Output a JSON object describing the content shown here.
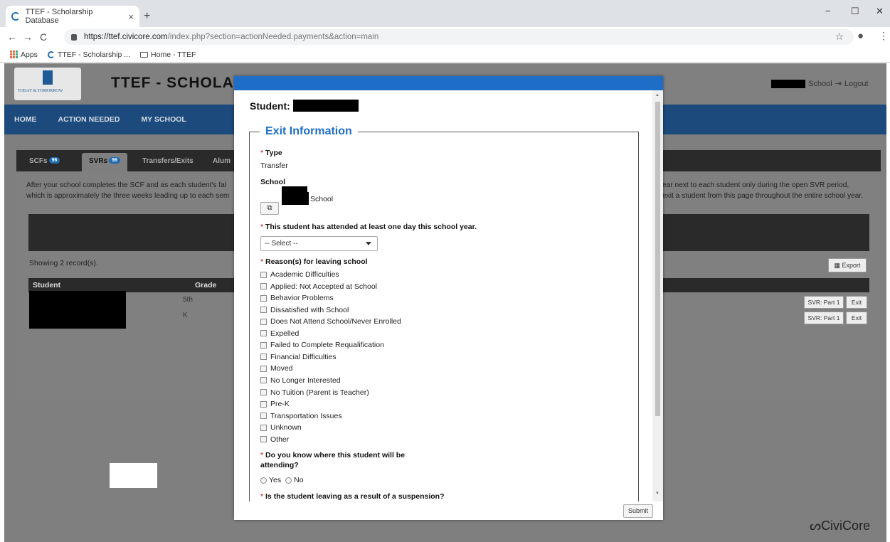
{
  "browser": {
    "tab_title": "TTEF - Scholarship Database",
    "tab_close": "×",
    "new_tab": "+",
    "url_host": "https://ttef.civicore.com",
    "url_path": "/index.php?section=actionNeeded.payments&action=main",
    "bookmarks": [
      "Apps",
      "TTEF - Scholarship ...",
      "Home - TTEF"
    ],
    "nav": {
      "back": "←",
      "forward": "→",
      "reload": "C"
    },
    "win": {
      "min": "−",
      "max": "☐",
      "close": "✕"
    },
    "star": "☆",
    "account": "●",
    "menu": "⋮"
  },
  "site": {
    "title": "TTEF - SCHOLARS",
    "logo_text": "TODAY & TOMORROW",
    "header_right_school": "School",
    "logout": "Logout",
    "nav": [
      "HOME",
      "ACTION NEEDED",
      "MY SCHOOL"
    ],
    "footer_brand": "CiviCore"
  },
  "panel": {
    "tabs": [
      {
        "label": "SCFs",
        "badge": "96"
      },
      {
        "label": "SVRs",
        "badge": "96"
      },
      {
        "label": "Transfers/Exits",
        "badge": ""
      },
      {
        "label": "Alum",
        "badge": ""
      }
    ],
    "desc_left_1": "After your school completes the SCF and as each student's fal",
    "desc_left_2": "which is approximately the three weeks leading up to each sem",
    "desc_right_1": "ear next to each student only during the open SVR period,",
    "desc_right_2": "exit a student from this page throughout the entire school year.",
    "showing": "Showing 2 record(s).",
    "export": "Export",
    "columns": [
      "Student",
      "Grade"
    ],
    "rows": [
      {
        "grade": "5th",
        "svr": "SVR: Part 1",
        "exit": "Exit"
      },
      {
        "grade": "K",
        "svr": "SVR: Part 1",
        "exit": "Exit"
      }
    ]
  },
  "modal": {
    "student_label": "Student:",
    "legend": "Exit Information",
    "type_label": "Type",
    "type_value": "Transfer",
    "school_label": "School",
    "school_suffix": "School",
    "ext_icon": "⧉",
    "attended_label": "This student has attended at least one day this school year.",
    "select_value": "-- Select --",
    "reasons_label": "Reason(s) for leaving school",
    "reasons": [
      "Academic Difficulties",
      "Applied: Not Accepted at School",
      "Behavior Problems",
      "Dissatisfied with School",
      "Does Not Attend School/Never Enrolled",
      "Expelled",
      "Failed to Complete Requalification",
      "Financial Difficulties",
      "Moved",
      "No Longer Interested",
      "No Tuition (Parent is Teacher)",
      "Pre-K",
      "Transportation Issues",
      "Unknown",
      "Other"
    ],
    "q_where_1": "Do you know where this student will be",
    "q_where_2": "attending?",
    "q_suspension": "Is the student leaving as a result of a suspension?",
    "yes": "Yes",
    "no": "No",
    "required_mark": "*",
    "submit": "Submit"
  }
}
